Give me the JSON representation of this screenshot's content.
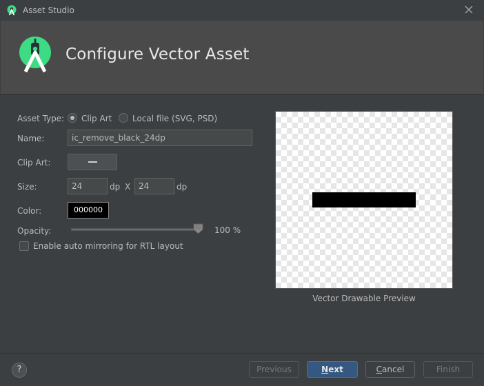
{
  "window": {
    "title": "Asset Studio",
    "app_icon": "android-studio-icon",
    "close_icon": "close-icon"
  },
  "header": {
    "logo_icon": "android-studio-logo",
    "heading": "Configure Vector Asset"
  },
  "form": {
    "asset_type_label": "Asset Type:",
    "asset_type_options": [
      {
        "label": "Clip Art",
        "selected": true
      },
      {
        "label": "Local file (SVG, PSD)",
        "selected": false
      }
    ],
    "name_label": "Name:",
    "name_value": "ic_remove_black_24dp",
    "clip_art_label": "Clip Art:",
    "clip_art_icon": "remove-icon",
    "size_label": "Size:",
    "size_width": "24",
    "size_height": "24",
    "size_unit": "dp",
    "size_separator": "X",
    "color_label": "Color:",
    "color_value": "000000",
    "color_hex": "#000000",
    "opacity_label": "Opacity:",
    "opacity_value": "100 %",
    "opacity_fraction": 1.0,
    "rtl_checkbox_label": "Enable auto mirroring for RTL layout",
    "rtl_checked": false
  },
  "preview": {
    "caption": "Vector Drawable Preview"
  },
  "footer": {
    "help_label": "?",
    "buttons": {
      "previous": "Previous",
      "next_mnemonic": "N",
      "next_rest": "ext",
      "cancel_mnemonic": "C",
      "cancel_rest": "ancel",
      "finish": "Finish"
    }
  },
  "colors": {
    "background": "#3c3f41",
    "header": "#4a4a4a",
    "primary_button": "#365880",
    "android_green": "#3ddc84"
  }
}
